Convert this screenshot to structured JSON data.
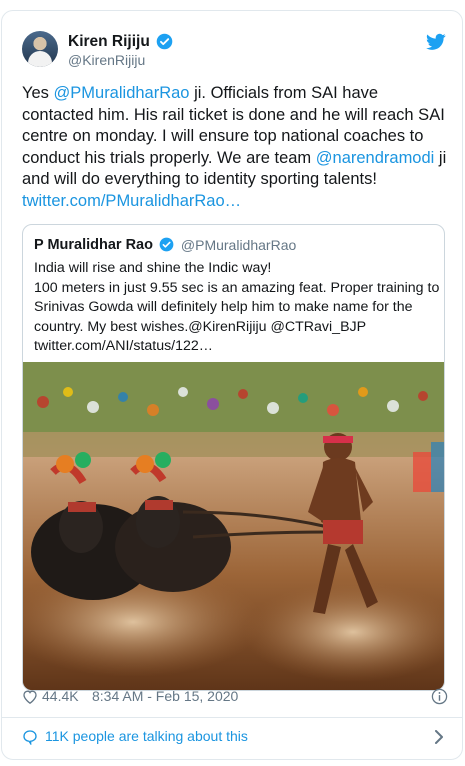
{
  "author": {
    "display_name": "Kiren Rijiju",
    "handle": "@KirenRijiju"
  },
  "tweet": {
    "text_parts": [
      {
        "text": "Yes ",
        "type": "text"
      },
      {
        "text": "@PMuralidharRao",
        "type": "mention"
      },
      {
        "text": " ji. Officials from SAI have contacted him. His rail ticket is done and he will reach SAI centre on monday. I will ensure top national coaches to conduct his trials properly. We are team ",
        "type": "text"
      },
      {
        "text": "@narendramodi",
        "type": "mention"
      },
      {
        "text": " ji and will do everything to identity sporting talents!",
        "type": "text"
      }
    ],
    "link": "twitter.com/PMuralidharRao…"
  },
  "quoted": {
    "display_name": "P Muralidhar Rao",
    "handle": "@PMuralidharRao",
    "lines": [
      "India will rise and shine the Indic way!",
      "100 meters in just 9.55 sec is an amazing feat. Proper training to",
      "Srinivas Gowda will definitely help him to make name for the",
      "country. My best wishes.@KirenRijiju @CTRavi_BJP",
      "twitter.com/ANI/status/122…"
    ]
  },
  "meta": {
    "likes": "44.4K",
    "timestamp": "8:34 AM - Feb 15, 2020"
  },
  "footer": {
    "talking": "11K people are talking about this"
  },
  "colors": {
    "link": "#1b95e0",
    "verified": "#1da1f2",
    "text": "#14171a",
    "muted": "#657786"
  }
}
